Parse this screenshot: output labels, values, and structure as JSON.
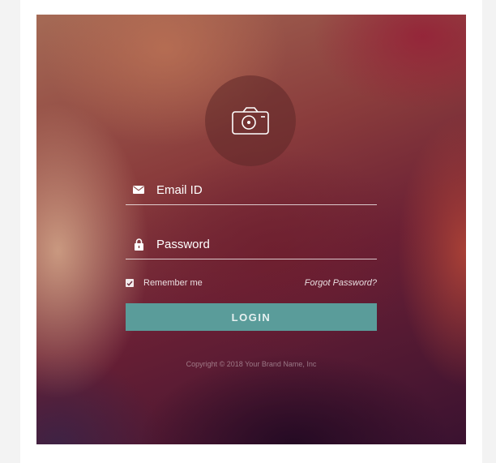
{
  "avatar": {
    "icon": "camera-icon"
  },
  "email": {
    "placeholder": "Email ID",
    "icon": "envelope-icon"
  },
  "password": {
    "placeholder": "Password",
    "icon": "lock-icon"
  },
  "remember": {
    "label": "Remember me",
    "checked": true
  },
  "forgot": {
    "label": "Forgot Password?"
  },
  "login": {
    "label": "LOGIN",
    "color": "#5a9c9a"
  },
  "footer": {
    "copyright": "Copyright © 2018 Your Brand Name, Inc"
  }
}
